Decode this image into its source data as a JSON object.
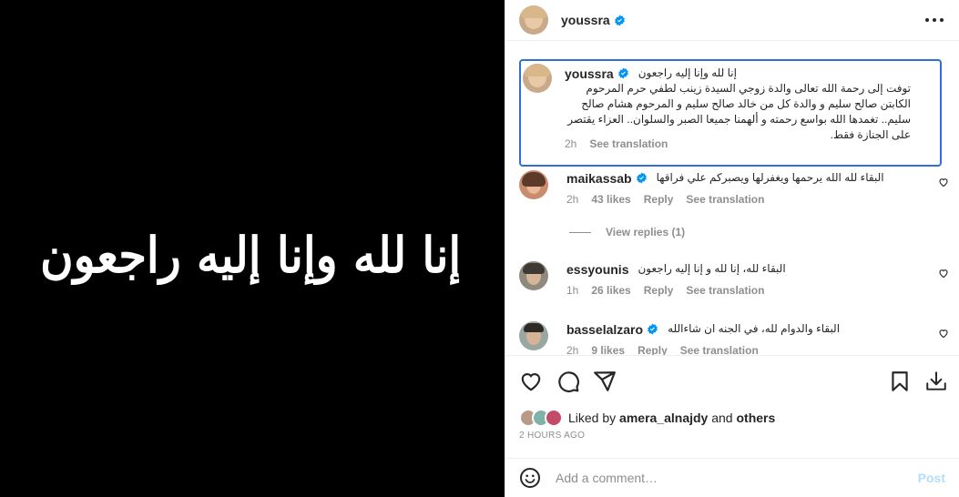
{
  "post": {
    "image_text": "إنا لله وإنا إليه راجعون"
  },
  "header": {
    "username": "youssra",
    "verified": true,
    "more_icon": "more-horizontal-icon"
  },
  "caption": {
    "username": "youssra",
    "line1": "إنا لله وإنا إليه راجعون",
    "body": "توفت إلى رحمة الله تعالى والدة زوجي السيدة زينب لطفي حرم المرحوم الكابتن صالح سليم و والدة كل من خالد صالح سليم و المرحوم هشام صالح سليم.. تغمدها الله بواسع رحمته و ألهمنا جميعا الصبر والسلوان.. العزاء يقتصر على الجنازة فقط.",
    "time": "2h",
    "see_translation": "See translation"
  },
  "comments": [
    {
      "username": "maikassab",
      "text": "البقاء لله الله يرحمها ويغفرلها ويصبركم علي فراقها",
      "time": "2h",
      "likes": "43 likes",
      "reply": "Reply",
      "see_translation": "See translation"
    },
    {
      "username": "essyounis",
      "text": "البقاء لله، إنا لله و إنا إليه راجعون",
      "time": "1h",
      "likes": "26 likes",
      "reply": "Reply",
      "see_translation": "See translation"
    },
    {
      "username": "basselalzaro",
      "text": "البقاء والدوام لله، في الجنه ان شاءالله",
      "time": "2h",
      "likes": "9 likes",
      "reply": "Reply",
      "see_translation": "See translation"
    }
  ],
  "view_replies": "View replies (1)",
  "liked_by": {
    "prefix": "Liked by",
    "user": "amera_alnajdy",
    "and": "and",
    "others": "others"
  },
  "time_ago": "2 HOURS AGO",
  "add_comment": {
    "placeholder": "Add a comment…",
    "post": "Post"
  },
  "colors": {
    "accent": "#0095f6",
    "highlight_border": "#2f6fd6",
    "post_disabled": "#b2dffc"
  }
}
